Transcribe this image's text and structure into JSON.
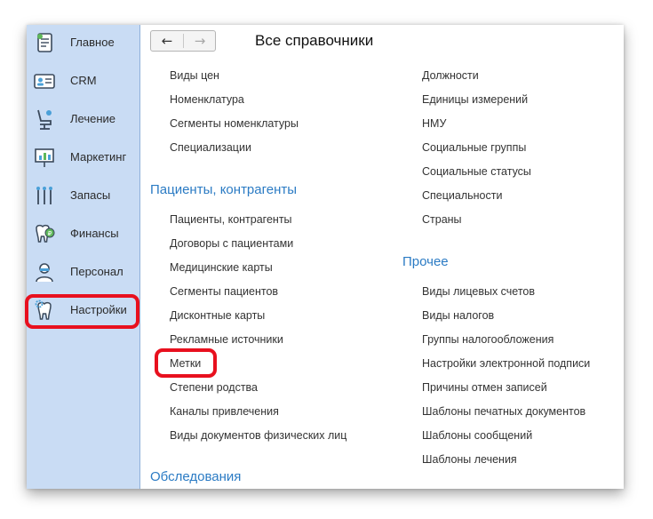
{
  "sidebar": {
    "items": [
      {
        "label": "Главное",
        "icon": "home-icon"
      },
      {
        "label": "CRM",
        "icon": "id-card-icon"
      },
      {
        "label": "Лечение",
        "icon": "dental-chair-icon"
      },
      {
        "label": "Маркетинг",
        "icon": "presentation-icon"
      },
      {
        "label": "Запасы",
        "icon": "dental-tools-icon"
      },
      {
        "label": "Финансы",
        "icon": "tooth-coin-icon"
      },
      {
        "label": "Персонал",
        "icon": "doctor-icon"
      },
      {
        "label": "Настройки",
        "icon": "tooth-gear-icon"
      }
    ]
  },
  "toolbar": {
    "back": "←",
    "forward": "→"
  },
  "page": {
    "title": "Все справочники"
  },
  "left_column": {
    "top_links": [
      "Виды цен",
      "Номенклатура",
      "Сегменты номенклатуры",
      "Специализации"
    ],
    "section_patients": "Пациенты, контрагенты",
    "patients_links": [
      "Пациенты, контрагенты",
      "Договоры с пациентами",
      "Медицинские карты",
      "Сегменты пациентов",
      "Дисконтные карты",
      "Рекламные источники",
      "Метки",
      "Степени родства",
      "Каналы привлечения",
      "Виды документов физических лиц"
    ],
    "section_exams": "Обследования"
  },
  "right_column": {
    "top_links": [
      "Должности",
      "Единицы измерений",
      "НМУ",
      "Социальные группы",
      "Социальные статусы",
      "Специальности",
      "Страны"
    ],
    "section_other": "Прочее",
    "other_links": [
      "Виды лицевых счетов",
      "Виды налогов",
      "Группы налогообложения",
      "Настройки электронной подписи",
      "Причины отмен записей",
      "Шаблоны печатных документов",
      "Шаблоны сообщений",
      "Шаблоны лечения"
    ]
  },
  "colors": {
    "highlight": "#e8101e",
    "section": "#2b7bc4",
    "sidebar": "#c9dcf4"
  }
}
